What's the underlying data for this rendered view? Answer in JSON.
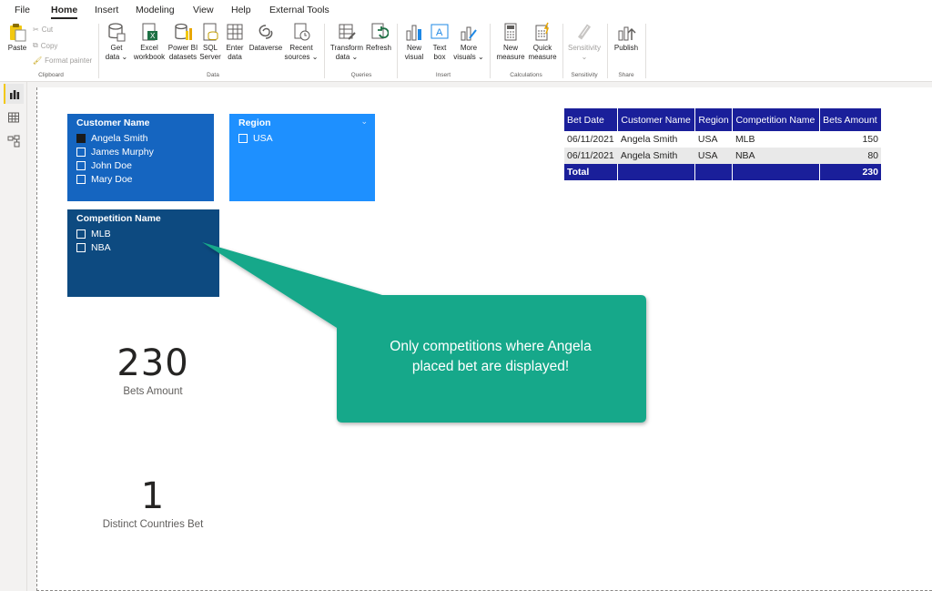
{
  "menu": {
    "file": "File",
    "home": "Home",
    "insert": "Insert",
    "modeling": "Modeling",
    "view": "View",
    "help": "Help",
    "external_tools": "External Tools"
  },
  "ribbon": {
    "clipboard": {
      "paste": "Paste",
      "cut": "Cut",
      "copy": "Copy",
      "format_painter": "Format painter",
      "group": "Clipboard"
    },
    "data": {
      "get_data_1": "Get",
      "get_data_2": "data ⌄",
      "excel_1": "Excel",
      "excel_2": "workbook",
      "powerbi_1": "Power BI",
      "powerbi_2": "datasets",
      "sql_1": "SQL",
      "sql_2": "Server",
      "enter_1": "Enter",
      "enter_2": "data",
      "dataverse": "Dataverse",
      "recent_1": "Recent",
      "recent_2": "sources ⌄",
      "group": "Data"
    },
    "queries": {
      "transform_1": "Transform",
      "transform_2": "data ⌄",
      "refresh": "Refresh",
      "group": "Queries"
    },
    "insert": {
      "new_visual_1": "New",
      "new_visual_2": "visual",
      "text_box_1": "Text",
      "text_box_2": "box",
      "more_1": "More",
      "more_2": "visuals ⌄",
      "group": "Insert"
    },
    "calculations": {
      "new_measure_1": "New",
      "new_measure_2": "measure",
      "quick_1": "Quick",
      "quick_2": "measure",
      "group": "Calculations"
    },
    "sensitivity": {
      "label": "Sensitivity",
      "caret": "⌄",
      "group": "Sensitivity"
    },
    "share": {
      "publish": "Publish",
      "group": "Share"
    }
  },
  "slicers": {
    "customer": {
      "title": "Customer Name",
      "items": [
        "Angela Smith",
        "James Murphy",
        "John Doe",
        "Mary Doe"
      ],
      "selected": "Angela Smith"
    },
    "region": {
      "title": "Region",
      "items": [
        "USA"
      ]
    },
    "competition": {
      "title": "Competition Name",
      "items": [
        "MLB",
        "NBA"
      ]
    }
  },
  "table": {
    "headers": [
      "Bet Date",
      "Customer Name",
      "Region",
      "Competition Name",
      "Bets Amount"
    ],
    "rows": [
      [
        "06/11/2021",
        "Angela Smith",
        "USA",
        "MLB",
        "150"
      ],
      [
        "06/11/2021",
        "Angela Smith",
        "USA",
        "NBA",
        "80"
      ]
    ],
    "total_label": "Total",
    "total_value": "230"
  },
  "cards": {
    "bets_amount": {
      "value": "230",
      "label": "Bets Amount"
    },
    "distinct_countries": {
      "value": "1",
      "label": "Distinct Countries Bet"
    }
  },
  "callout": {
    "line1": "Only competitions where Angela",
    "line2": "placed bet are displayed!"
  },
  "colors": {
    "customer_slicer": "#1565c0",
    "region_slicer": "#1e90ff",
    "competition_slicer": "#0d4a80",
    "table_header": "#1a1f9a",
    "callout": "#16a88a"
  }
}
